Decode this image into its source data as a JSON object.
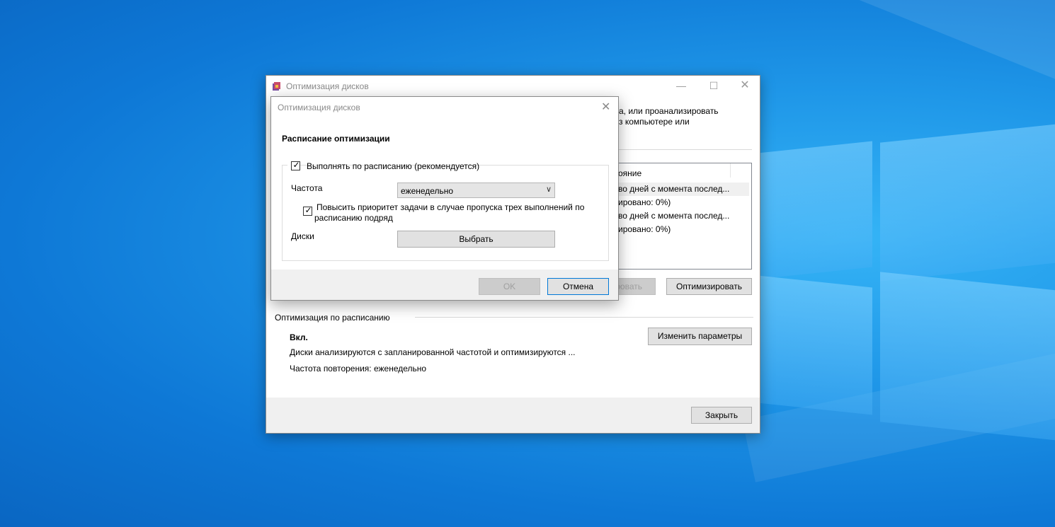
{
  "main_window": {
    "title": "Оптимизация дисков",
    "description_line1": "а, или проанализировать",
    "description_line2": "з компьютере или",
    "list": {
      "column_header": "ояние",
      "rows": [
        "во дней с момента послед...",
        "ировано: 0%)",
        "во дней с момента послед...",
        "ировано: 0%)"
      ]
    },
    "analyze_button_label": "ровать",
    "optimize_button_label": "Оптимизировать",
    "schedule": {
      "section_title": "Оптимизация по расписанию",
      "status": "Вкл.",
      "description": "Диски анализируются с запланированной частотой и оптимизируются ...",
      "frequency_text": "Частота повторения: еженедельно",
      "change_button_label": "Изменить параметры"
    },
    "close_button_label": "Закрыть"
  },
  "dialog": {
    "title": "Оптимизация дисков",
    "heading": "Расписание оптимизации",
    "run_on_schedule": {
      "label": "Выполнять по расписанию (рекомендуется)",
      "checked": true
    },
    "frequency_label": "Частота",
    "frequency_value": "еженедельно",
    "priority": {
      "label_line1": "Повысить приоритет задачи в случае пропуска трех выполнений по",
      "label_line2": "расписанию подряд",
      "checked": true
    },
    "disks_label": "Диски",
    "choose_button_label": "Выбрать",
    "ok_label": "OK",
    "cancel_label": "Отмена"
  }
}
